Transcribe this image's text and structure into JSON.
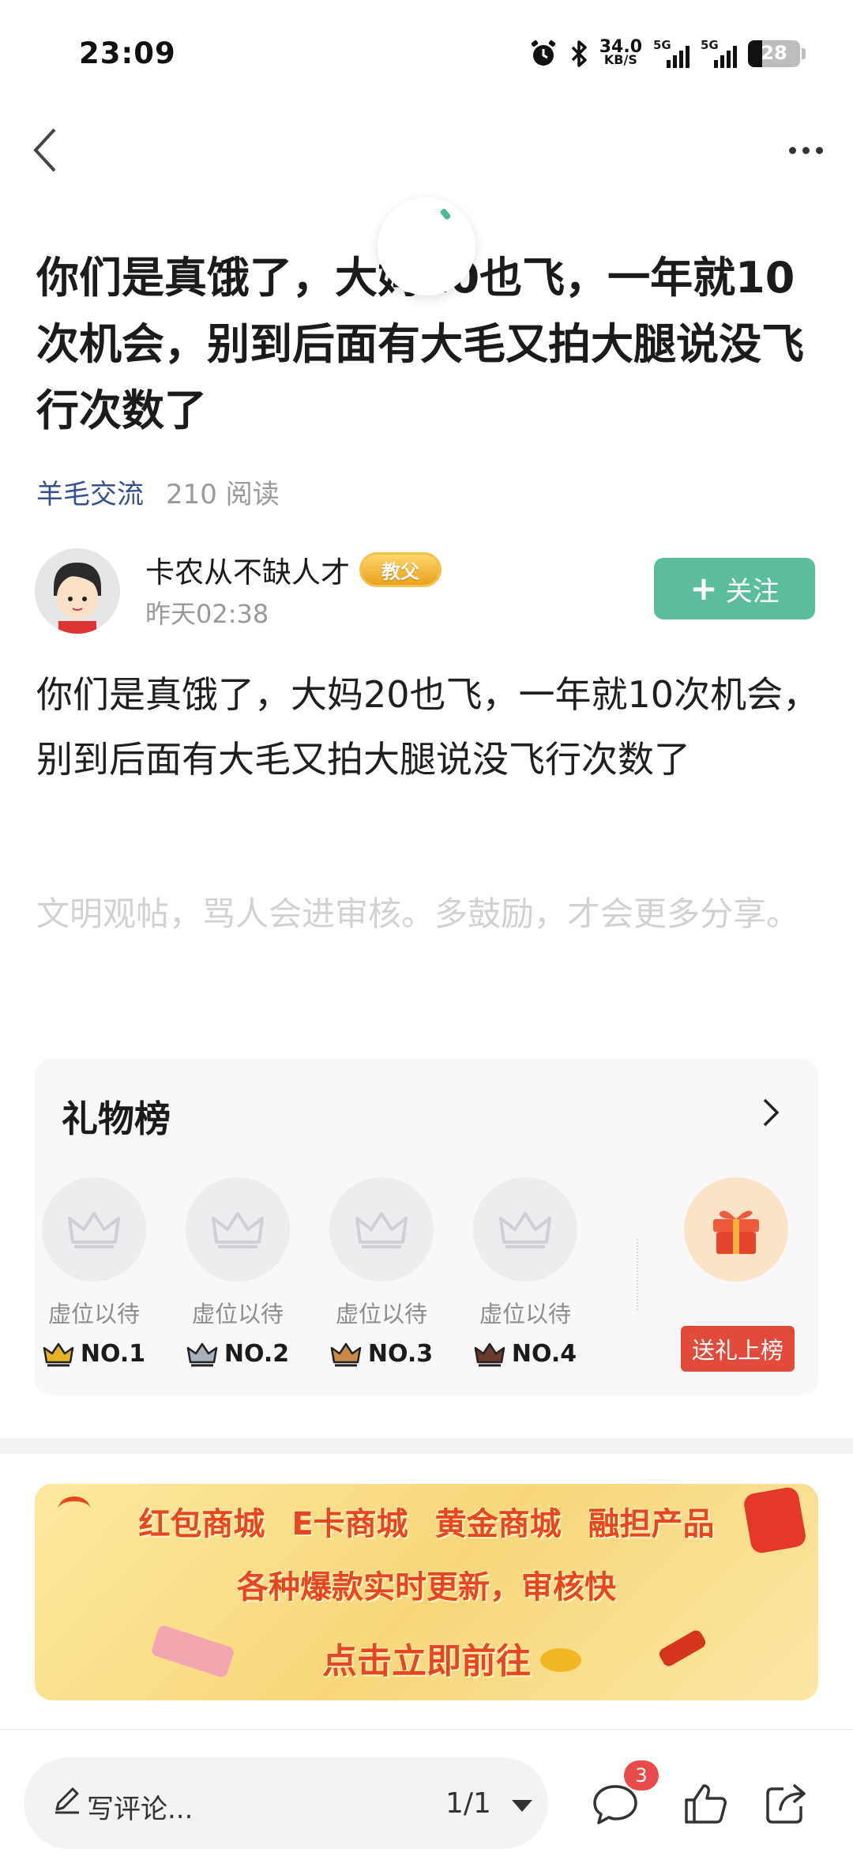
{
  "status_bar": {
    "time": "23:09",
    "net_speed_value": "34.0",
    "net_speed_unit": "KB/S",
    "signal1_label": "5G",
    "signal2_label": "5G",
    "battery": "28"
  },
  "post": {
    "title": "你们是真饿了，大妈20也飞，一年就10次机会，别到后面有大毛又拍大腿说没飞行次数了",
    "category": "羊毛交流",
    "reads": "210 阅读",
    "content": "你们是真饿了，大妈20也飞，一年就10次机会，别到后面有大毛又拍大腿说没飞行次数了",
    "notice": "文明观帖，骂人会进审核。多鼓励，才会更多分享。"
  },
  "author": {
    "name": "卡农从不缺人才",
    "badge": "教父",
    "time": "昨天02:38",
    "follow_label": "关注"
  },
  "gift_board": {
    "title": "礼物榜",
    "slots": [
      {
        "label": "虚位以待",
        "rank": "NO.1"
      },
      {
        "label": "虚位以待",
        "rank": "NO.2"
      },
      {
        "label": "虚位以待",
        "rank": "NO.3"
      },
      {
        "label": "虚位以待",
        "rank": "NO.4"
      }
    ],
    "send_label": "送礼上榜",
    "rank_colors": [
      "#e6b422",
      "#a9b0bb",
      "#c98a4a",
      "#6b3a2c"
    ]
  },
  "banner": {
    "line1": "红包商城 E卡商城 黄金商城 融担产品",
    "line2": "各种爆款实时更新，审核快",
    "line3": "点击立即前往"
  },
  "bottom_bar": {
    "comment_placeholder": "写评论...",
    "pages": "1/1",
    "comment_count": "3"
  },
  "accent": "#5bbd9b"
}
